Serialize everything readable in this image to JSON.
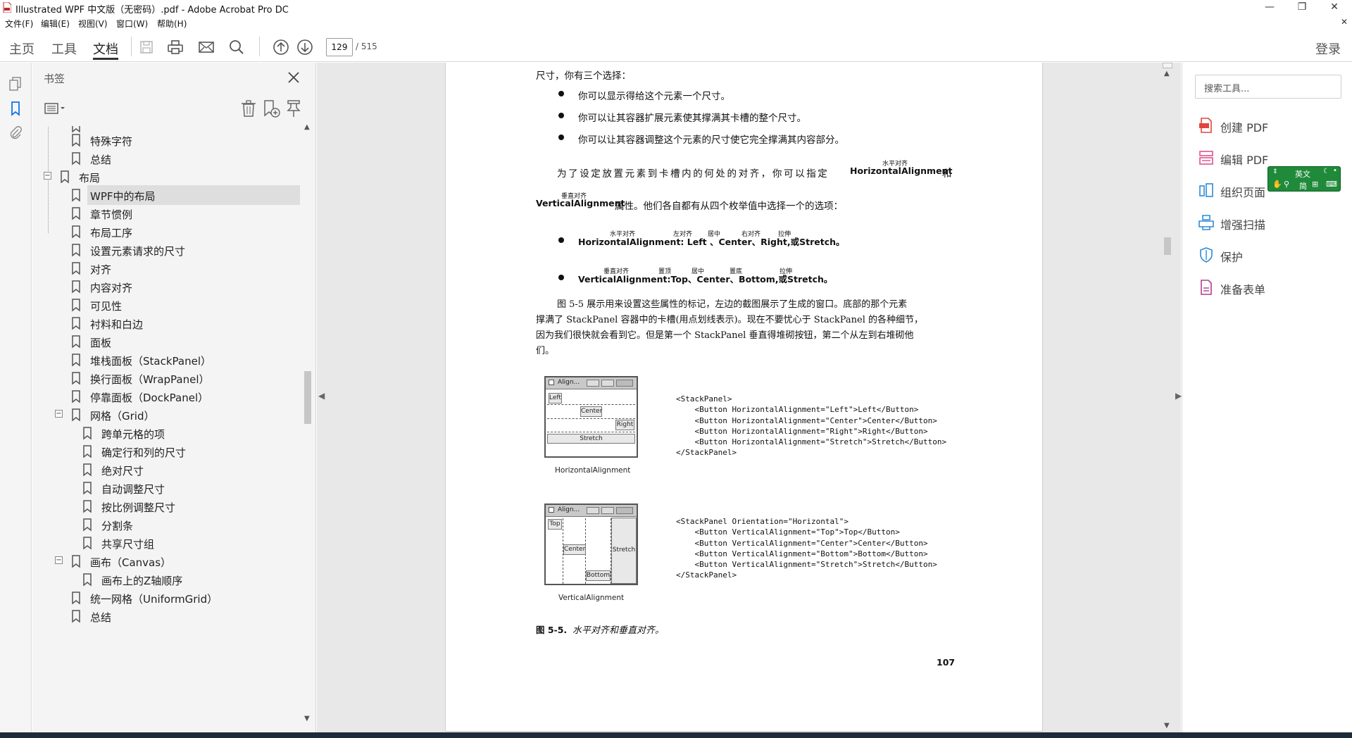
{
  "window": {
    "title": "Illustrated WPF 中文版（无密码）.pdf - Adobe Acrobat Pro DC",
    "menus": [
      "文件(F)",
      "编辑(E)",
      "视图(V)",
      "窗口(W)",
      "帮助(H)"
    ]
  },
  "toolbar": {
    "tabs": [
      "主页",
      "工具",
      "文档"
    ],
    "active_tab": "文档",
    "page_current": "129",
    "page_total": "/ 515",
    "login_label": "登录"
  },
  "bookmarks": {
    "title": "书签",
    "items": [
      {
        "label": "特殊字符",
        "level": 2
      },
      {
        "label": "总结",
        "level": 2
      },
      {
        "label": "布局",
        "level": 1,
        "expanded": true
      },
      {
        "label": "WPF中的布局",
        "level": 2,
        "selected": true
      },
      {
        "label": "章节惯例",
        "level": 2
      },
      {
        "label": "布局工序",
        "level": 2
      },
      {
        "label": "设置元素请求的尺寸",
        "level": 2
      },
      {
        "label": "对齐",
        "level": 2
      },
      {
        "label": "内容对齐",
        "level": 2
      },
      {
        "label": "可见性",
        "level": 2
      },
      {
        "label": "衬料和白边",
        "level": 2
      },
      {
        "label": "面板",
        "level": 2
      },
      {
        "label": "堆栈面板（StackPanel）",
        "level": 2
      },
      {
        "label": "换行面板（WrapPanel）",
        "level": 2
      },
      {
        "label": "停靠面板（DockPanel）",
        "level": 2
      },
      {
        "label": "网格（Grid）",
        "level": 2,
        "expanded": true
      },
      {
        "label": "跨单元格的项",
        "level": 3
      },
      {
        "label": "确定行和列的尺寸",
        "level": 3
      },
      {
        "label": "绝对尺寸",
        "level": 3
      },
      {
        "label": "自动调整尺寸",
        "level": 3
      },
      {
        "label": "按比例调整尺寸",
        "level": 3
      },
      {
        "label": "分割条",
        "level": 3
      },
      {
        "label": "共享尺寸组",
        "level": 3
      },
      {
        "label": "画布（Canvas）",
        "level": 2,
        "expanded": true
      },
      {
        "label": "画布上的Z轴顺序",
        "level": 3
      },
      {
        "label": "统一网格（UniformGrid）",
        "level": 2
      },
      {
        "label": "总结",
        "level": 2
      }
    ]
  },
  "document": {
    "line_intro": "尺寸，你有三个选择：",
    "bullets1": [
      "你可以显示得给这个元素一个尺寸。",
      "你可以让其容器扩展元素使其撑满其卡槽的整个尺寸。",
      "你可以让其容器调整这个元素的尺寸使它完全撑满其内容部分。"
    ],
    "para1_a": "为了设定放置元素到卡槽内的何处的对齐，你可以指定",
    "para1_b": "HorizontalAlignment",
    "para1_c": "和",
    "para1_d": "VerticalAlignment",
    "para1_e": "属性。他们各自都有从四个枚举值中选择一个的选项：",
    "ruby_h": "水平对齐",
    "ruby_v": "垂直对齐",
    "bullet_h": "HorizontalAlignment: Left 、Center、Right,或Stretch。",
    "bullet_h_rubies": [
      "水平对齐",
      "左对齐",
      "居中",
      "右对齐",
      "拉伸"
    ],
    "bullet_v": "VerticalAlignment:Top、Center、Bottom,或Stretch。",
    "bullet_v_rubies": [
      "垂直对齐",
      "置顶",
      "居中",
      "置底",
      "拉伸"
    ],
    "para2": [
      "图 5-5 展示用来设置这些属性的标记，左边的截图展示了生成的窗口。底部的那个元素",
      "撑满了 StackPanel 容器中的卡槽(用点划线表示)。现在不要忧心于 StackPanel 的各种细节，",
      "因为我们很快就会看到它。但是第一个 StackPanel 垂直得堆砌按钮，第二个从左到右堆砌他",
      "们。"
    ],
    "fig1": {
      "window_title": "Align...",
      "buttons": [
        "Left",
        "Center",
        "Right",
        "Stretch"
      ],
      "label": "HorizontalAlignment",
      "code": "<StackPanel>\n    <Button HorizontalAlignment=\"Left\">Left</Button>\n    <Button HorizontalAlignment=\"Center\">Center</Button>\n    <Button HorizontalAlignment=\"Right\">Right</Button>\n    <Button HorizontalAlignment=\"Stretch\">Stretch</Button>\n</StackPanel>"
    },
    "fig2": {
      "window_title": "Align...",
      "buttons": [
        "Top",
        "Center",
        "Bottom",
        "Stretch"
      ],
      "label": "VerticalAlignment",
      "code": "<StackPanel Orientation=\"Horizontal\">\n    <Button VerticalAlignment=\"Top\">Top</Button>\n    <Button VerticalAlignment=\"Center\">Center</Button>\n    <Button VerticalAlignment=\"Bottom\">Bottom</Button>\n    <Button VerticalAlignment=\"Stretch\">Stretch</Button>\n</StackPanel>"
    },
    "figure_caption_num": "图 5-5.",
    "figure_caption_text": "水平对齐和垂直对齐。",
    "page_number": "107"
  },
  "right_panel": {
    "search_placeholder": "搜索工具...",
    "tools": [
      {
        "label": "创建 PDF",
        "icon": "create-pdf-icon",
        "color": "#e0463d"
      },
      {
        "label": "编辑 PDF",
        "icon": "edit-pdf-icon",
        "color": "#e2508e"
      },
      {
        "label": "组织页面",
        "icon": "organize-pages-icon",
        "color": "#2f8ad6"
      },
      {
        "label": "增强扫描",
        "icon": "enhance-scan-icon",
        "color": "#2f8ad6"
      },
      {
        "label": "保护",
        "icon": "protect-icon",
        "color": "#2f8ad6"
      },
      {
        "label": "准备表单",
        "icon": "prepare-form-icon",
        "color": "#b43c8e"
      }
    ]
  },
  "ime": {
    "mode": "英文",
    "charset": "简"
  }
}
